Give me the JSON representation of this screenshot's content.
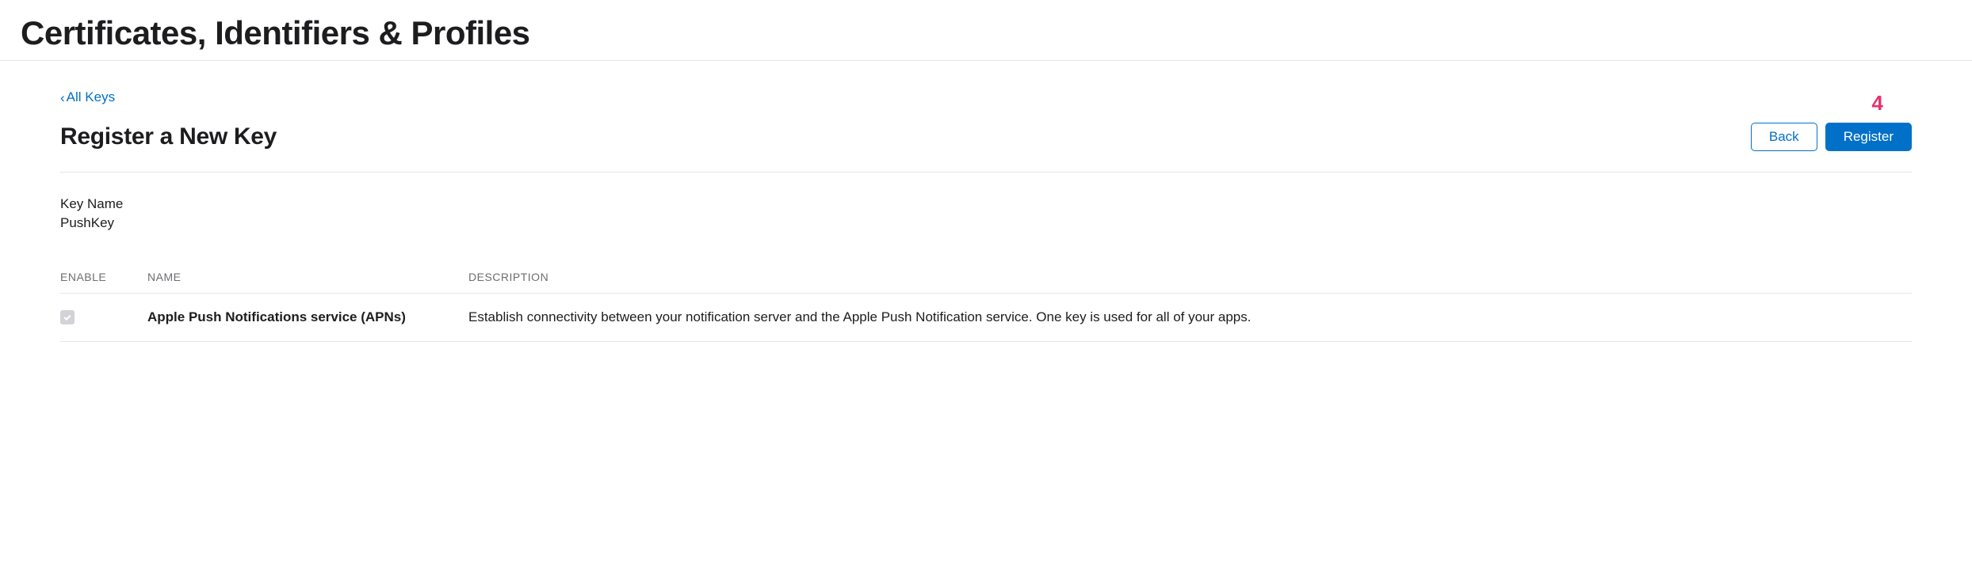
{
  "page": {
    "title": "Certificates, Identifiers & Profiles"
  },
  "nav": {
    "back_link": "All Keys"
  },
  "header": {
    "section_title": "Register a New Key",
    "back_button": "Back",
    "register_button": "Register",
    "annotation": "4"
  },
  "key": {
    "name_label": "Key Name",
    "name_value": "PushKey"
  },
  "table": {
    "headers": {
      "enable": "ENABLE",
      "name": "NAME",
      "description": "DESCRIPTION"
    },
    "rows": [
      {
        "enabled": true,
        "name": "Apple Push Notifications service (APNs)",
        "description": "Establish connectivity between your notification server and the Apple Push Notification service. One key is used for all of your apps."
      }
    ]
  }
}
